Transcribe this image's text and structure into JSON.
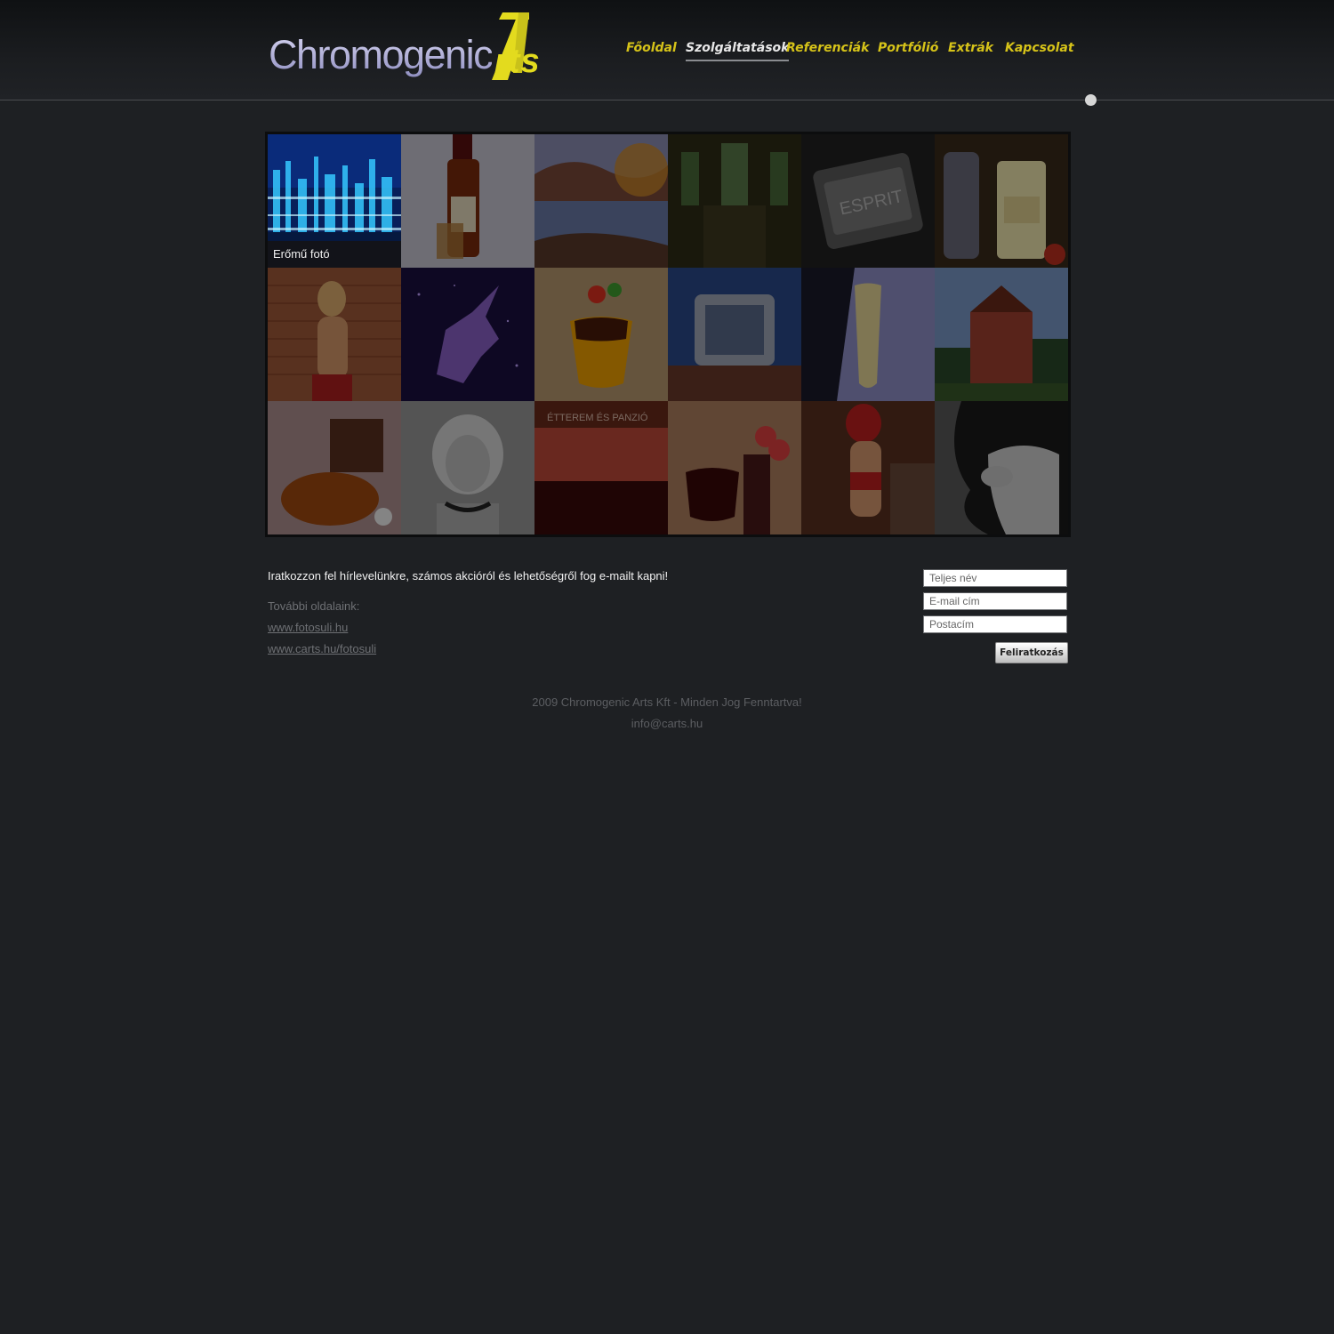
{
  "brand": {
    "name_main": "Chromogenic",
    "name_tail": "rts",
    "accent": "#e3db1e",
    "logo_color": "#b9b8dc"
  },
  "nav": {
    "items": [
      {
        "label": "Főoldal"
      },
      {
        "label": "Szolgáltatások",
        "active": true
      },
      {
        "label": "Referenciák"
      },
      {
        "label": "Portfólió"
      },
      {
        "label": "Extrák"
      },
      {
        "label": "Kapcsolat"
      }
    ],
    "color": "#d6c319"
  },
  "gallery": {
    "hover_caption": "Erőmű fotó",
    "tiles": [
      {
        "subject": "power-plant-night"
      },
      {
        "subject": "bacardi-bottle"
      },
      {
        "subject": "autumn-lake"
      },
      {
        "subject": "church-interior"
      },
      {
        "subject": "esprit-watch-strap"
      },
      {
        "subject": "bacardi-cocktail"
      },
      {
        "subject": "model-brick-wall"
      },
      {
        "subject": "glass-unicorn"
      },
      {
        "subject": "layered-cocktail"
      },
      {
        "subject": "square-watch"
      },
      {
        "subject": "champagne-glass"
      },
      {
        "subject": "brick-manor-house"
      },
      {
        "subject": "punch-bowl"
      },
      {
        "subject": "portrait-woman"
      },
      {
        "subject": "restaurant-facade"
      },
      {
        "subject": "red-wine-grapes"
      },
      {
        "subject": "red-lingerie-model"
      },
      {
        "subject": "polar-bear-ice"
      }
    ]
  },
  "newsletter": {
    "text": "Iratkozzon fel hírlevelünkre, számos akcióról és lehetőségről fog e-mailt kapni!",
    "name_placeholder": "Teljes név",
    "email_placeholder": "E-mail cím",
    "address_placeholder": "Postacím",
    "button": "Feliratkozás"
  },
  "links": {
    "label": "További oldalaink:",
    "items": [
      "www.fotosuli.hu",
      "www.carts.hu/fotosuli"
    ]
  },
  "footer": {
    "copyright": "2009 Chromogenic Arts Kft - Minden Jog Fenntartva!",
    "email": "info@carts.hu"
  }
}
